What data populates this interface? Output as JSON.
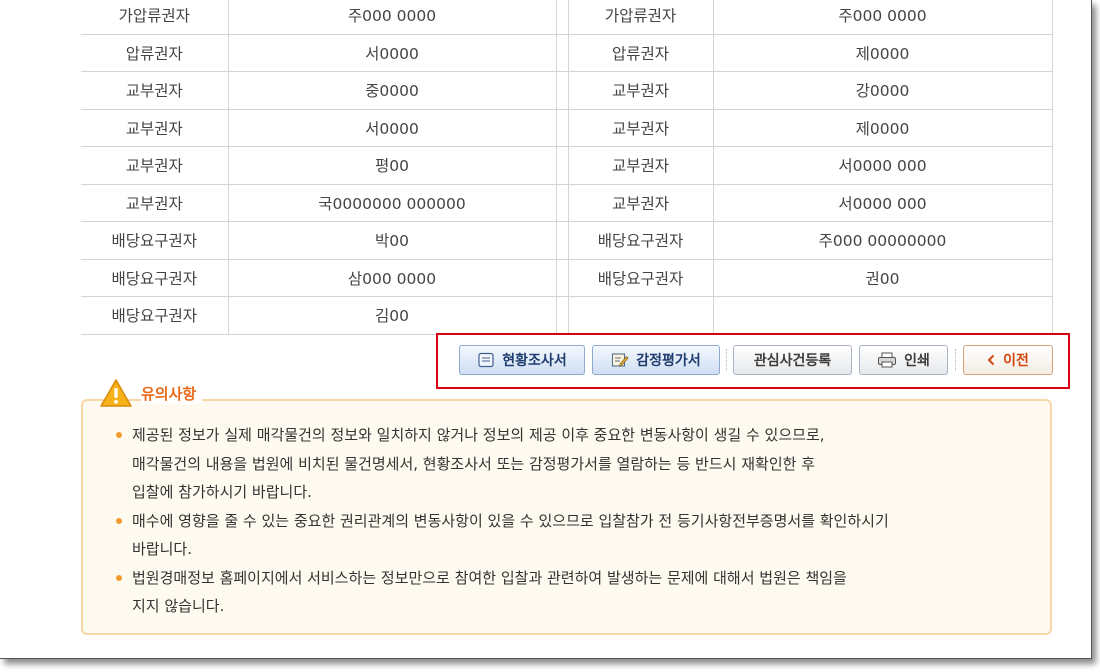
{
  "rights_table": {
    "rows": [
      {
        "l_type": "가압류권자",
        "l_name": "주000 0000",
        "r_type": "가압류권자",
        "r_name": "주000 0000"
      },
      {
        "l_type": "압류권자",
        "l_name": "서0000",
        "r_type": "압류권자",
        "r_name": "제0000"
      },
      {
        "l_type": "교부권자",
        "l_name": "중0000",
        "r_type": "교부권자",
        "r_name": "강0000"
      },
      {
        "l_type": "교부권자",
        "l_name": "서0000",
        "r_type": "교부권자",
        "r_name": "제0000"
      },
      {
        "l_type": "교부권자",
        "l_name": "평00",
        "r_type": "교부권자",
        "r_name": "서0000 000"
      },
      {
        "l_type": "교부권자",
        "l_name": "국0000000 000000",
        "r_type": "교부권자",
        "r_name": "서0000 000"
      },
      {
        "l_type": "배당요구권자",
        "l_name": "박00",
        "r_type": "배당요구권자",
        "r_name": "주000 00000000"
      },
      {
        "l_type": "배당요구권자",
        "l_name": "삼000 0000",
        "r_type": "배당요구권자",
        "r_name": "권00"
      },
      {
        "l_type": "배당요구권자",
        "l_name": "김00",
        "r_type": "",
        "r_name": ""
      }
    ]
  },
  "buttons": {
    "status_report": {
      "label": "현황조사서",
      "icon": "document-icon"
    },
    "appraisal": {
      "label": "감정평가서",
      "icon": "edit-document-icon"
    },
    "interest": {
      "label": "관심사건등록"
    },
    "print": {
      "label": "인쇄",
      "icon": "printer-icon"
    },
    "prev": {
      "label": "이전",
      "icon": "chevron-left-icon"
    }
  },
  "notice": {
    "title": "유의사항",
    "items": [
      {
        "lines": [
          "제공된 정보가 실제 매각물건의 정보와 일치하지 않거나 정보의 제공 이후 중요한 변동사항이 생길 수 있으므로,",
          "매각물건의 내용을 법원에 비치된 물건명세서, 현황조사서 또는 감정평가서를 열람하는 등 반드시 재확인한 후",
          "입찰에 참가하시기 바랍니다."
        ]
      },
      {
        "lines": [
          "매수에 영향을 줄 수 있는 중요한 권리관계의 변동사항이 있을 수 있으므로 입찰참가 전 등기사항전부증명서를 확인하시기",
          "바랍니다."
        ]
      },
      {
        "lines": [
          "법원경매정보 홈페이지에서 서비스하는 정보만으로 참여한 입찰과 관련하여 발생하는 문제에 대해서 법원은 책임을",
          "지지 않습니다."
        ]
      }
    ]
  },
  "colors": {
    "highlight_border": "#d9000f",
    "notice_bg": "#fffaef",
    "notice_border": "#f6d8a8",
    "notice_title": "#e96a1b"
  }
}
